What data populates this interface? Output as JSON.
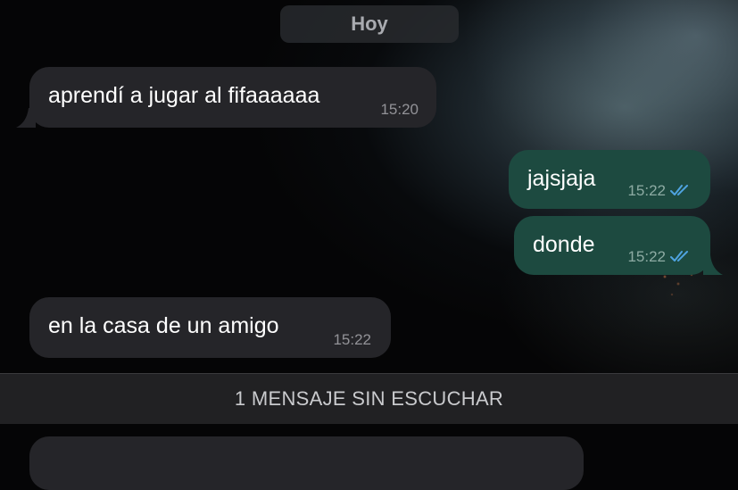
{
  "chat": {
    "date_label": "Hoy",
    "messages": [
      {
        "text": "aprendí a jugar al fifaaaaaa",
        "time": "15:20",
        "direction": "incoming"
      },
      {
        "text": "jajsjaja",
        "time": "15:22",
        "direction": "outgoing",
        "status": "read"
      },
      {
        "text": "donde",
        "time": "15:22",
        "direction": "outgoing",
        "status": "read"
      },
      {
        "text": "en la casa de un amigo",
        "time": "15:22",
        "direction": "incoming"
      }
    ],
    "unread_banner": "1 MENSAJE SIN ESCUCHAR"
  },
  "colors": {
    "incoming_bubble": "#252529",
    "outgoing_bubble": "#1d4a40",
    "read_ticks": "#4fa3e0",
    "background": "#050506"
  },
  "icons": {
    "read_status": "double-check-icon"
  }
}
